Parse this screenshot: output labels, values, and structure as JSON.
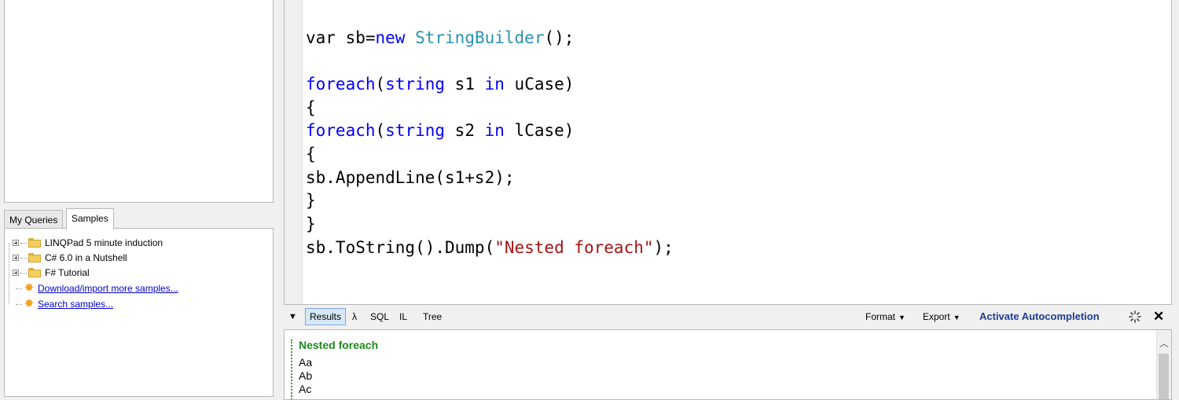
{
  "left_panel": {
    "tabs": [
      {
        "label": "My Queries",
        "active": false
      },
      {
        "label": "Samples",
        "active": true
      }
    ],
    "tree": [
      {
        "label": "LINQPad 5 minute induction",
        "kind": "folder",
        "icon": "folder-icon"
      },
      {
        "label": "C# 6.0 in a Nutshell",
        "kind": "folder",
        "icon": "folder-icon"
      },
      {
        "label": "F# Tutorial",
        "kind": "folder",
        "icon": "folder-icon"
      },
      {
        "label": "Download/import more samples...",
        "kind": "link",
        "icon": "star-icon"
      },
      {
        "label": "Search samples...",
        "kind": "link",
        "icon": "star-icon"
      }
    ]
  },
  "editor": {
    "code": {
      "line1_a": "var sb=",
      "line1_b": "new",
      "line1_c": " ",
      "line1_d": "StringBuilder",
      "line1_e": "();",
      "line2_a": "foreach",
      "line2_b": "(",
      "line2_c": "string",
      "line2_d": " s1 ",
      "line2_e": "in",
      "line2_f": " uCase)",
      "line3": "{",
      "line4_a": "foreach",
      "line4_b": "(",
      "line4_c": "string",
      "line4_d": " s2 ",
      "line4_e": "in",
      "line4_f": " lCase)",
      "line5": "{",
      "line6": "sb.AppendLine(s1+s2);",
      "line7": "}",
      "line8": "}",
      "line9_a": "sb.ToString().Dump(",
      "line9_b": "\"Nested foreach\"",
      "line9_c": ");"
    }
  },
  "results_toolbar": {
    "collapse_glyph": "▼",
    "tabs": [
      "Results",
      "λ",
      "SQL",
      "IL",
      "Tree"
    ],
    "format_label": "Format",
    "export_label": "Export",
    "autocomplete_label": "Activate Autocompletion",
    "caret": "▼",
    "close_glyph": "✕"
  },
  "results": {
    "title": "Nested foreach",
    "lines": [
      "Aa",
      "Ab",
      "Ac"
    ]
  },
  "colors": {
    "keyword": "#0000ff",
    "type": "#2b91af",
    "string": "#a31515",
    "results_title": "#1a8a1a",
    "link": "#0000cc",
    "autocomplete": "#1c3c94"
  }
}
